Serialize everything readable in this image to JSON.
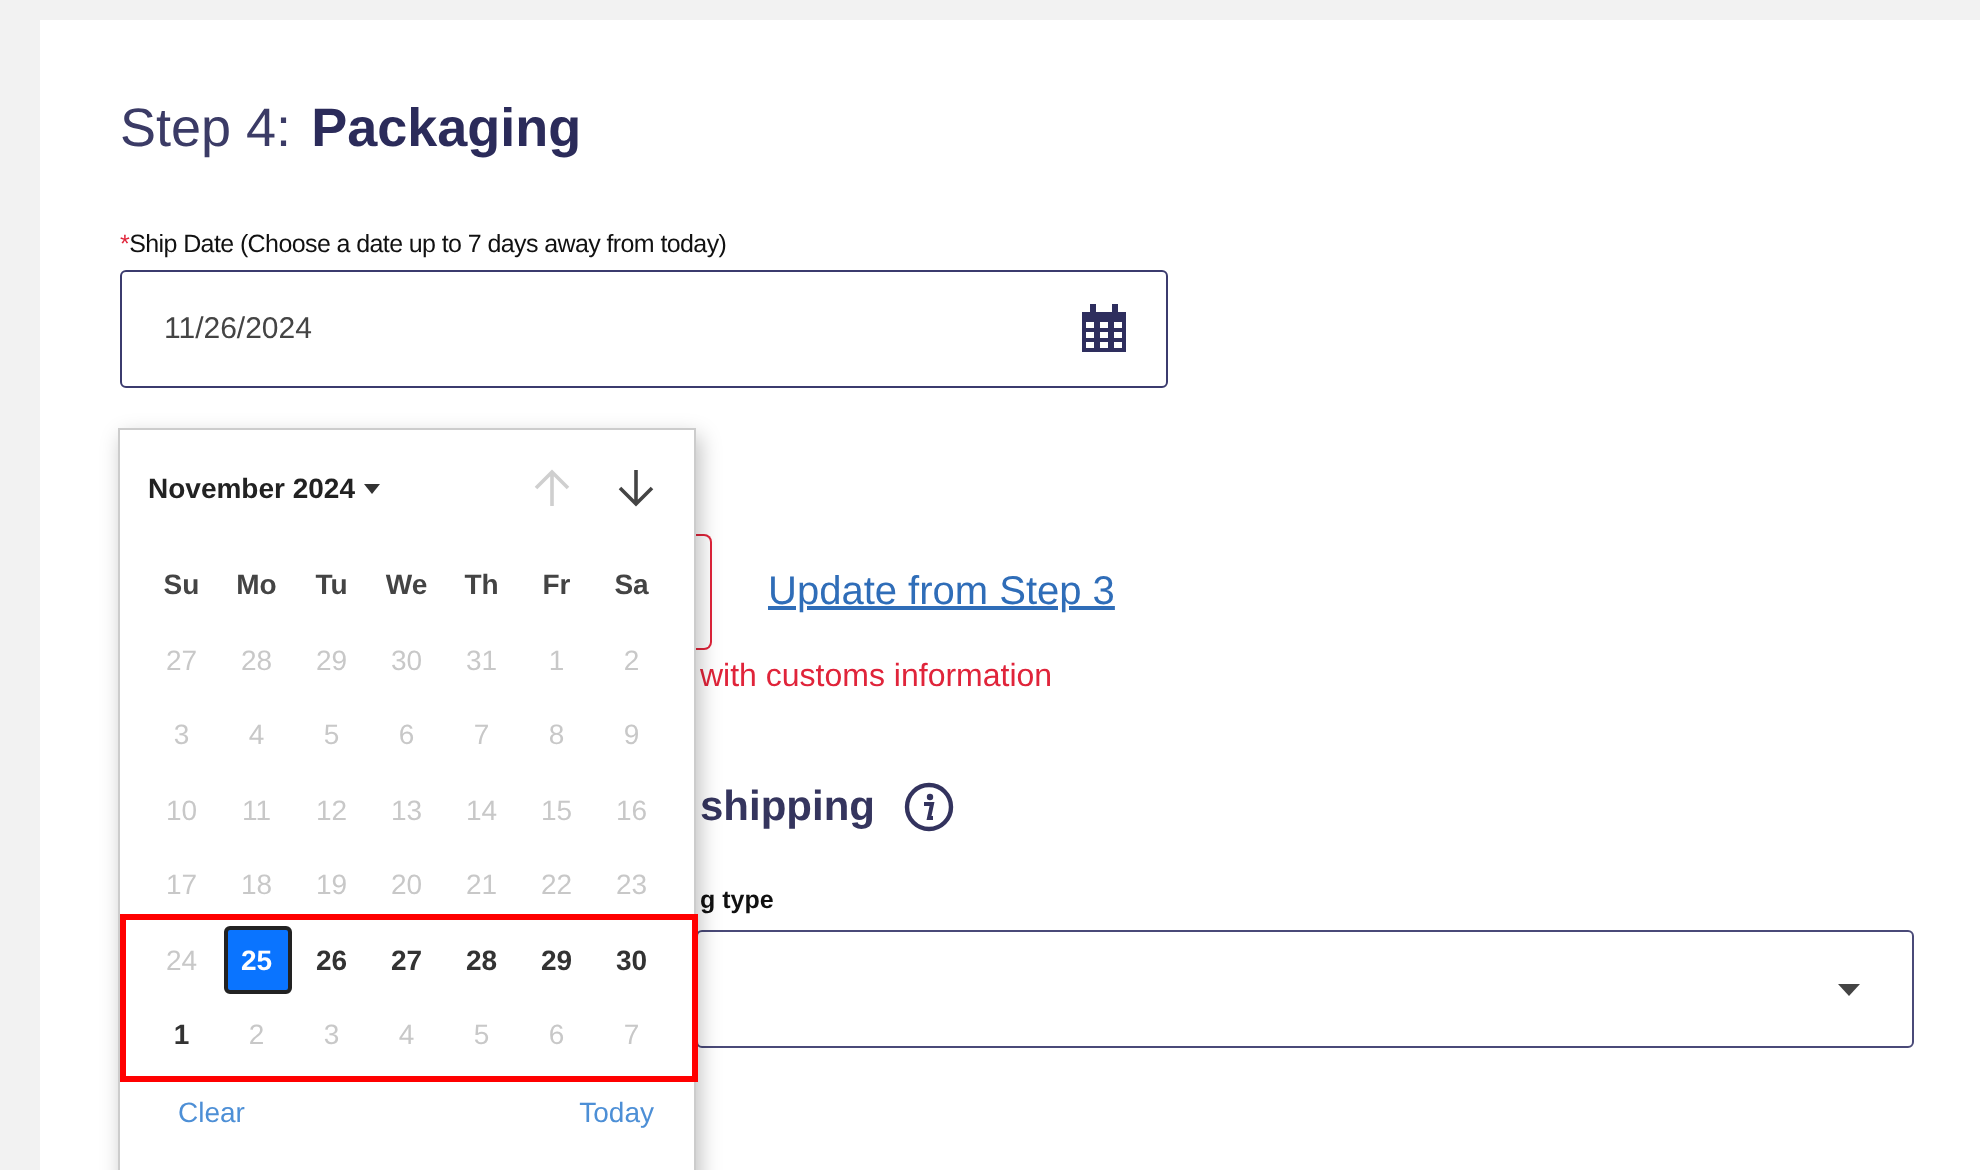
{
  "header": {
    "step": "Step 4:",
    "title": "Packaging"
  },
  "ship_date": {
    "required_mark": "*",
    "label": "Ship Date (Choose a date up to 7 days away from today)",
    "value": "11/26/2024"
  },
  "calendar": {
    "month": "November 2024",
    "nav": [
      {
        "kind": "up",
        "disabled": true
      },
      {
        "kind": "down",
        "disabled": false
      }
    ],
    "weekdays": [
      "Su",
      "Mo",
      "Tu",
      "We",
      "Th",
      "Fr",
      "Sa"
    ],
    "weeks": [
      {
        "highlighted": false,
        "days": [
          {
            "label": "27",
            "disabled": true,
            "selected": false
          },
          {
            "label": "28",
            "disabled": true,
            "selected": false
          },
          {
            "label": "29",
            "disabled": true,
            "selected": false
          },
          {
            "label": "30",
            "disabled": true,
            "selected": false
          },
          {
            "label": "31",
            "disabled": true,
            "selected": false
          },
          {
            "label": "1",
            "disabled": true,
            "selected": false
          },
          {
            "label": "2",
            "disabled": true,
            "selected": false
          }
        ]
      },
      {
        "highlighted": false,
        "days": [
          {
            "label": "3",
            "disabled": true,
            "selected": false
          },
          {
            "label": "4",
            "disabled": true,
            "selected": false
          },
          {
            "label": "5",
            "disabled": true,
            "selected": false
          },
          {
            "label": "6",
            "disabled": true,
            "selected": false
          },
          {
            "label": "7",
            "disabled": true,
            "selected": false
          },
          {
            "label": "8",
            "disabled": true,
            "selected": false
          },
          {
            "label": "9",
            "disabled": true,
            "selected": false
          }
        ]
      },
      {
        "highlighted": false,
        "days": [
          {
            "label": "10",
            "disabled": true,
            "selected": false
          },
          {
            "label": "11",
            "disabled": true,
            "selected": false
          },
          {
            "label": "12",
            "disabled": true,
            "selected": false
          },
          {
            "label": "13",
            "disabled": true,
            "selected": false
          },
          {
            "label": "14",
            "disabled": true,
            "selected": false
          },
          {
            "label": "15",
            "disabled": true,
            "selected": false
          },
          {
            "label": "16",
            "disabled": true,
            "selected": false
          }
        ]
      },
      {
        "highlighted": false,
        "days": [
          {
            "label": "17",
            "disabled": true,
            "selected": false
          },
          {
            "label": "18",
            "disabled": true,
            "selected": false
          },
          {
            "label": "19",
            "disabled": true,
            "selected": false
          },
          {
            "label": "20",
            "disabled": true,
            "selected": false
          },
          {
            "label": "21",
            "disabled": true,
            "selected": false
          },
          {
            "label": "22",
            "disabled": true,
            "selected": false
          },
          {
            "label": "23",
            "disabled": true,
            "selected": false
          }
        ]
      },
      {
        "highlighted": true,
        "days": [
          {
            "label": "24",
            "disabled": true,
            "selected": false
          },
          {
            "label": "25",
            "disabled": false,
            "selected": true
          },
          {
            "label": "26",
            "disabled": false,
            "selected": false
          },
          {
            "label": "27",
            "disabled": false,
            "selected": false
          },
          {
            "label": "28",
            "disabled": false,
            "selected": false
          },
          {
            "label": "29",
            "disabled": false,
            "selected": false
          },
          {
            "label": "30",
            "disabled": false,
            "selected": false
          }
        ]
      },
      {
        "highlighted": true,
        "days": [
          {
            "label": "1",
            "disabled": false,
            "selected": false
          },
          {
            "label": "2",
            "disabled": true,
            "selected": false
          },
          {
            "label": "3",
            "disabled": true,
            "selected": false
          },
          {
            "label": "4",
            "disabled": true,
            "selected": false
          },
          {
            "label": "5",
            "disabled": true,
            "selected": false
          },
          {
            "label": "6",
            "disabled": true,
            "selected": false
          },
          {
            "label": "7",
            "disabled": true,
            "selected": false
          }
        ]
      }
    ],
    "clear": "Clear",
    "today": "Today"
  },
  "behind": {
    "update_link": "Update from Step 3",
    "error": "with customs information",
    "section_heading": "shipping",
    "field_label": "g type"
  }
}
